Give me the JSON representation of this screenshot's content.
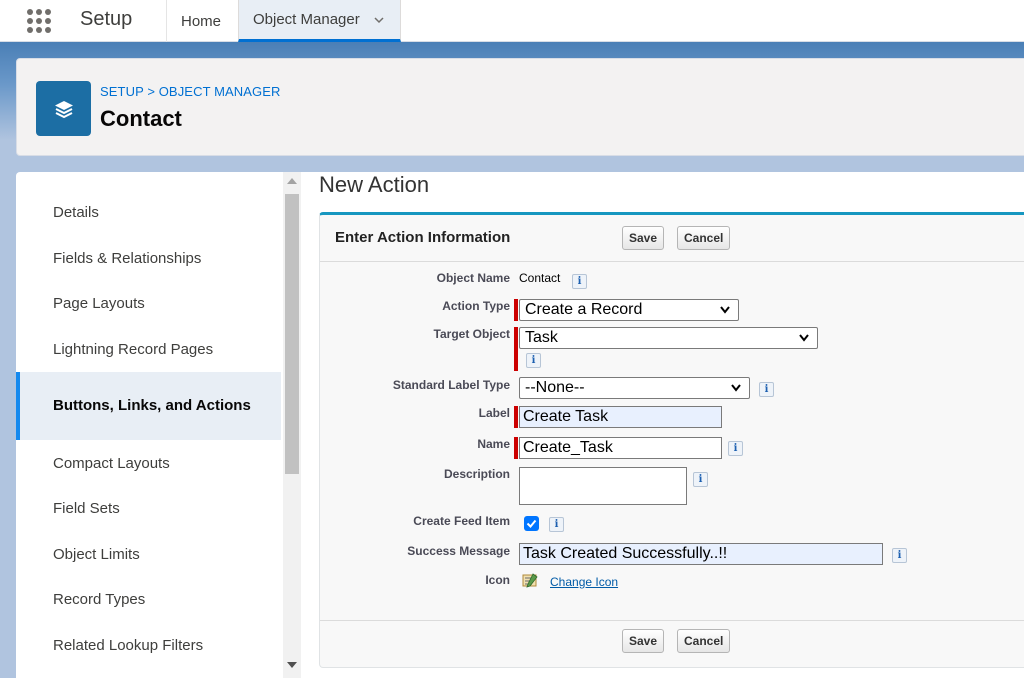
{
  "topnav": {
    "app_name": "Setup",
    "tabs": [
      {
        "label": "Home"
      },
      {
        "label": "Object Manager"
      }
    ]
  },
  "header": {
    "breadcrumb": "SETUP > OBJECT MANAGER",
    "title": "Contact"
  },
  "sidebar": {
    "items": [
      {
        "label": "Details"
      },
      {
        "label": "Fields & Relationships"
      },
      {
        "label": "Page Layouts"
      },
      {
        "label": "Lightning Record Pages"
      },
      {
        "label": "Buttons, Links, and Actions"
      },
      {
        "label": "Compact Layouts"
      },
      {
        "label": "Field Sets"
      },
      {
        "label": "Object Limits"
      },
      {
        "label": "Record Types"
      },
      {
        "label": "Related Lookup Filters"
      }
    ],
    "active_index": 4
  },
  "main": {
    "title": "New Action",
    "block_title": "Enter Action Information",
    "save_label": "Save",
    "cancel_label": "Cancel",
    "fields": {
      "object_name": {
        "label": "Object Name",
        "value": "Contact"
      },
      "action_type": {
        "label": "Action Type",
        "value": "Create a Record"
      },
      "target_object": {
        "label": "Target Object",
        "value": "Task"
      },
      "standard_label_type": {
        "label": "Standard Label Type",
        "value": "--None--"
      },
      "label": {
        "label": "Label",
        "value": "Create Task"
      },
      "name": {
        "label": "Name",
        "value": "Create_Task"
      },
      "description": {
        "label": "Description",
        "value": ""
      },
      "create_feed_item": {
        "label": "Create Feed Item",
        "checked": true
      },
      "success_message": {
        "label": "Success Message",
        "value": "Task Created Successfully..!!"
      },
      "icon": {
        "label": "Icon",
        "link": "Change Icon"
      }
    },
    "info_glyph": "i"
  },
  "colors": {
    "accent": "#0070d2",
    "icon_bg": "#1c6ea4",
    "required": "#cc0000",
    "block_border": "#1797c0"
  }
}
